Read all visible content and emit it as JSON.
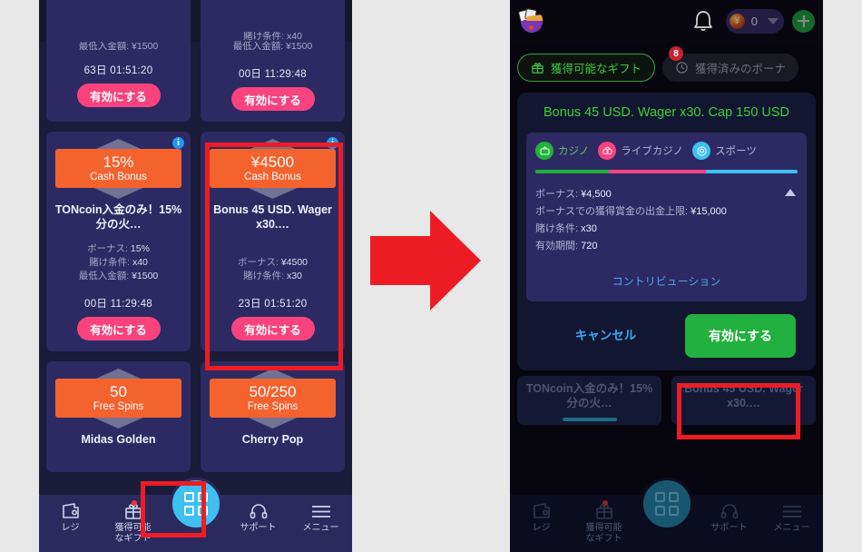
{
  "app": {
    "logo_name": "noodle-bowl-logo",
    "bell_icon": "bell-icon",
    "balance_value": "0",
    "currency_symbol": "¥",
    "add_funds_label": "+"
  },
  "left_phone": {
    "partial_cards": [
      {
        "clipped_meta": "最低入金額:  ¥1500",
        "timer": "63日  01:51:20",
        "activate_label": "有効にする"
      },
      {
        "clipped_meta": "賭け条件:  x40",
        "meta_visible": "最低入金額:  ¥1500",
        "timer": "00日  11:29:48",
        "activate_label": "有効にする"
      }
    ],
    "cards": [
      {
        "info_badge": "i",
        "ribbon_big": "15%",
        "ribbon_small": "Cash Bonus",
        "title": "TONcoin入金のみ！15%分の火…",
        "meta": [
          {
            "label": "ボーナス:",
            "value": "15%"
          },
          {
            "label": "賭け条件:",
            "value": "x40"
          },
          {
            "label": "最低入金額:",
            "value": "¥1500"
          }
        ],
        "timer": "00日  11:29:48",
        "activate_label": "有効にする",
        "highlighted": false
      },
      {
        "info_badge": "i",
        "ribbon_big": "¥4500",
        "ribbon_small": "Cash Bonus",
        "title": "Bonus 45 USD. Wager x30.…",
        "meta": [
          {
            "label": "ボーナス:",
            "value": "¥4500"
          },
          {
            "label": "賭け条件:",
            "value": "x30"
          }
        ],
        "timer": "23日  01:51:20",
        "activate_label": "有効にする",
        "highlighted": true
      }
    ],
    "bottom_cards": [
      {
        "ribbon_big": "50",
        "ribbon_small": "Free Spins",
        "title": "Midas Golden"
      },
      {
        "ribbon_big": "50/250",
        "ribbon_small": "Free Spins",
        "title": "Cherry Pop"
      }
    ],
    "nav": [
      {
        "icon": "wallet-icon",
        "label": "レジ",
        "dot": false
      },
      {
        "icon": "gift-icon",
        "label": "獲得可能\nなギフト",
        "dot": true,
        "highlighted": true
      },
      {
        "icon": "grid-icon",
        "label": "",
        "center": true
      },
      {
        "icon": "headset-icon",
        "label": "サポート",
        "dot": false
      },
      {
        "icon": "hamburger-icon",
        "label": "メニュー",
        "dot": false
      }
    ],
    "nav_labels": {
      "cashier": "レジ",
      "gifts_line1": "獲得可能",
      "gifts_line2": "なギフト",
      "support": "サポート",
      "menu": "メニュー"
    }
  },
  "right_phone": {
    "tabs": [
      {
        "label": "獲得可能なギフト",
        "icon": "gift-icon",
        "active": true,
        "badge": "8"
      },
      {
        "label": "獲得済みのボーナ",
        "icon": "clock-icon",
        "active": false
      }
    ],
    "modal": {
      "title": "Bonus 45 USD. Wager x30. Cap 150 USD",
      "categories": [
        {
          "name": "カジノ",
          "color": "#22b03f",
          "icon": "casino-chip-icon",
          "share": 28
        },
        {
          "name": "ライブカジノ",
          "color": "#f8437e",
          "icon": "live-casino-icon",
          "share": 37
        },
        {
          "name": "スポーツ",
          "color": "#3ec0f0",
          "icon": "sports-ball-icon",
          "share": 35
        }
      ],
      "details": [
        {
          "label": "ボーナス:",
          "value": "¥4,500"
        },
        {
          "label": "ボーナスでの獲得賞金の出金上限:",
          "value": "¥15,000"
        },
        {
          "label": "賭け条件:",
          "value": "x30"
        },
        {
          "label": "有効期間:",
          "value": "720"
        }
      ],
      "contribution_link": "コントリビューション",
      "cancel_label": "キャンセル",
      "activate_label": "有効にする",
      "collapse_icon": "chevron-up-icon"
    },
    "behind_cards": [
      {
        "title": "TONcoin入金のみ！15%分の火…"
      },
      {
        "title": "Bonus 45 USD. Wager x30.…"
      }
    ],
    "nav_labels": {
      "cashier": "レジ",
      "gifts_line1": "獲得可能",
      "gifts_line2": "なギフト",
      "support": "サポート",
      "menu": "メニュー"
    }
  },
  "annotation": {
    "arrow_color": "#ed1c24",
    "highlight_color": "#ed1c24"
  }
}
